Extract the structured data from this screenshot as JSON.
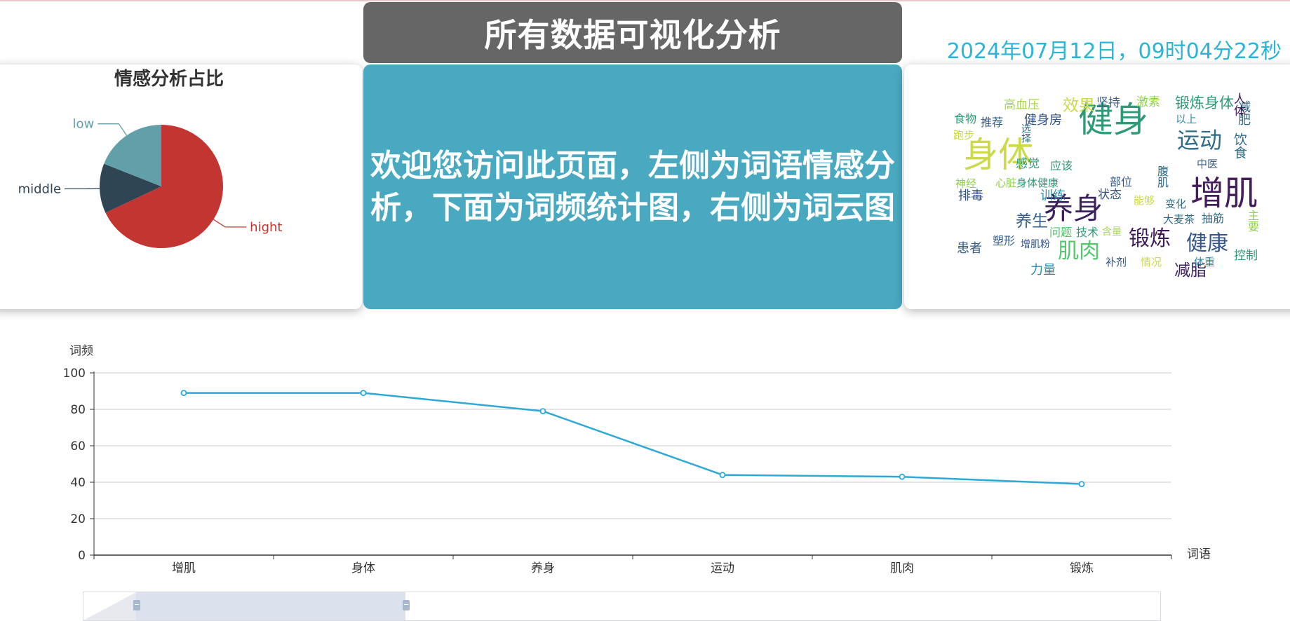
{
  "header": {
    "title": "所有数据可视化分析",
    "datetime": "2024年07月12日，09时04分22秒"
  },
  "welcome": {
    "line1": "欢迎您访问此页面，左侧为词语情感分",
    "line2": "析，下面为词频统计图，右侧为词云图"
  },
  "pie_chart": {
    "title": "情感分析占比"
  },
  "chart_data": [
    {
      "type": "pie",
      "title": "情感分析占比",
      "slices": [
        {
          "label": "hight",
          "value": 68,
          "color": "#c23531"
        },
        {
          "label": "middle",
          "value": 13,
          "color": "#2f4554"
        },
        {
          "label": "low",
          "value": 19,
          "color": "#61a0a8"
        }
      ]
    },
    {
      "type": "line",
      "title": "",
      "xlabel": "词语",
      "ylabel": "词频",
      "categories": [
        "增肌",
        "身体",
        "养身",
        "运动",
        "肌肉",
        "锻炼"
      ],
      "values": [
        89,
        89,
        79,
        44,
        43,
        39
      ],
      "ylim": [
        0,
        100
      ],
      "yticks": [
        0,
        20,
        40,
        60,
        80,
        100
      ],
      "grid": true,
      "color": "#2ea8d4"
    }
  ],
  "word_cloud": {
    "words": [
      {
        "text": "健身",
        "color": "#2e9a78"
      },
      {
        "text": "身体",
        "color": "#cbd94a"
      },
      {
        "text": "增肌",
        "color": "#451d5c"
      },
      {
        "text": "养身",
        "color": "#3b1f5e"
      },
      {
        "text": "运动",
        "color": "#2f6a88"
      },
      {
        "text": "肌肉",
        "color": "#53c76b"
      },
      {
        "text": "锻炼",
        "color": "#401a55"
      },
      {
        "text": "健康",
        "color": "#33558c"
      },
      {
        "text": "效果",
        "color": "#cbd94a"
      },
      {
        "text": "锻炼身体",
        "color": "#2e9a78"
      },
      {
        "text": "养生",
        "color": "#365f8c"
      },
      {
        "text": "减脂",
        "color": "#3b1f5e"
      },
      {
        "text": "训练",
        "color": "#2e8ea8"
      },
      {
        "text": "感觉",
        "color": "#2e9a78"
      },
      {
        "text": "患者",
        "color": "#365f8c"
      },
      {
        "text": "排毒",
        "color": "#33558c"
      },
      {
        "text": "力量",
        "color": "#2e8ea8"
      },
      {
        "text": "饮食",
        "color": "#2f6a88"
      },
      {
        "text": "减肥",
        "color": "#2f6a88"
      },
      {
        "text": "高血压",
        "color": "#a8d64c"
      },
      {
        "text": "坚持",
        "color": "#365f8c"
      },
      {
        "text": "激素",
        "color": "#8fd24a"
      },
      {
        "text": "食物",
        "color": "#2e9a78"
      },
      {
        "text": "推荐",
        "color": "#365f8c"
      },
      {
        "text": "健身房",
        "color": "#33558c"
      },
      {
        "text": "跑步",
        "color": "#cbd94a"
      },
      {
        "text": "人体",
        "color": "#401a55"
      },
      {
        "text": "以上",
        "color": "#2e8ea8"
      },
      {
        "text": "选择",
        "color": "#2f6a88"
      },
      {
        "text": "中医",
        "color": "#365f8c"
      },
      {
        "text": "应该",
        "color": "#2e9a78"
      },
      {
        "text": "神经",
        "color": "#8fd24a"
      },
      {
        "text": "心脏",
        "color": "#8fd24a"
      },
      {
        "text": "身体健康",
        "color": "#2e9a78"
      },
      {
        "text": "部位",
        "color": "#33558c"
      },
      {
        "text": "腹肌",
        "color": "#2f6a88"
      },
      {
        "text": "能够",
        "color": "#cbd94a"
      },
      {
        "text": "状态",
        "color": "#33558c"
      },
      {
        "text": "变化",
        "color": "#2f6a88"
      },
      {
        "text": "大麦茶",
        "color": "#2f6a88"
      },
      {
        "text": "抽筋",
        "color": "#2f6a88"
      },
      {
        "text": "主要",
        "color": "#8fd24a"
      },
      {
        "text": "问题",
        "color": "#53c76b"
      },
      {
        "text": "技术",
        "color": "#2e9a78"
      },
      {
        "text": "含量",
        "color": "#a8d64c"
      },
      {
        "text": "塑形",
        "color": "#365f8c"
      },
      {
        "text": "增肌粉",
        "color": "#33558c"
      },
      {
        "text": "补剂",
        "color": "#33558c"
      },
      {
        "text": "情况",
        "color": "#cbd94a"
      },
      {
        "text": "体重",
        "color": "#2e8ea8"
      },
      {
        "text": "控制",
        "color": "#2e9a78"
      }
    ]
  }
}
